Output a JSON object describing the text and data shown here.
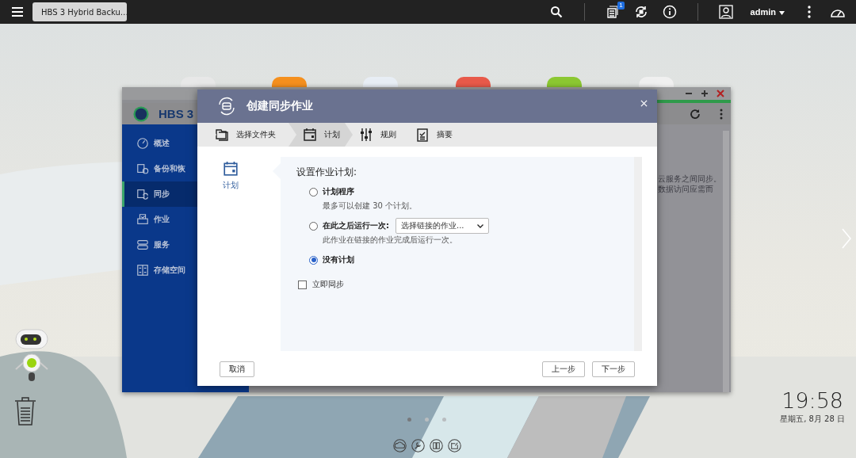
{
  "top_bar": {
    "tab": {
      "title": "HBS 3 Hybrid Backu…"
    },
    "notification_count": "1",
    "user": "admin"
  },
  "background_window": {
    "title": "HBS 3",
    "sidebar": [
      {
        "label": "概述",
        "selected": false
      },
      {
        "label": "备份和恢",
        "selected": false
      },
      {
        "label": "同步",
        "selected": true
      },
      {
        "label": "作业",
        "selected": false
      },
      {
        "label": "服务",
        "selected": false
      },
      {
        "label": "存储空间",
        "selected": false
      }
    ],
    "text_lines": [
      "云服务之间同步。",
      "数据访问应需而"
    ]
  },
  "dialog": {
    "title": "创建同步作业",
    "steps": [
      {
        "label": "选择文件夹",
        "selected": false
      },
      {
        "label": "计划",
        "selected": true
      },
      {
        "label": "规则",
        "selected": false
      },
      {
        "label": "摘要",
        "selected": false
      }
    ],
    "side_label": "计划",
    "section_title": "设置作业计划:",
    "options": [
      {
        "label": "计划程序",
        "note": "最多可以创建 30 个计划。",
        "selected": false
      },
      {
        "label": "在此之后运行一次:",
        "dropdown": "选择链接的作业...",
        "note": "此作业在链接的作业完成后运行一次。",
        "selected": false
      },
      {
        "label": "没有计划",
        "selected": true
      }
    ],
    "checkbox": {
      "label": "立即同步",
      "checked": false
    },
    "cancel_button": "取消",
    "buttons": [
      "上一步",
      "下一步"
    ]
  },
  "desktop": {
    "clock": "19:58",
    "date": "星期五, 8月 28 日",
    "pages": [
      {
        "selected": true
      },
      {
        "selected": false
      },
      {
        "selected": false
      }
    ]
  }
}
